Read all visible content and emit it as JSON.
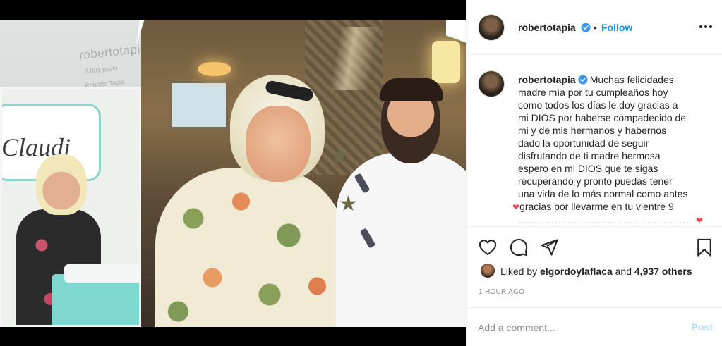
{
  "post": {
    "username": "robertotapia",
    "verified": true,
    "separator": "•",
    "follow_label": "Follow",
    "caption_lines": [
      "Muchas felicidades",
      "madre mía por tu cumpleaños hoy",
      "como todos los días le doy gracias a",
      "mi DIOS por haberse compadecido de",
      "mi y de mis hermanos y habernos",
      "dado la oportunidad de seguir",
      "disfrutando de ti madre hermosa",
      "espero en mi DIOS que te sigas",
      "recuperando y pronto puedas tener",
      "una vida de lo más normal como antes",
      "gracias por llevarme en tu vientre 9"
    ],
    "likes": {
      "prefix": "Liked by",
      "liker": "elgordoylaflaca",
      "joiner": "and",
      "others": "4,937 others"
    },
    "timestamp": "1 HOUR AGO",
    "comment_placeholder": "Add a comment...",
    "post_label": "Post"
  },
  "photo": {
    "collage_handle": "robertotapia",
    "collage_stat": "3,001 posts",
    "collage_name": "Roberto Tapia",
    "inset_banner": "Claudi"
  },
  "icons": {
    "more": "more-options-icon",
    "verified": "verified-badge-icon",
    "like": "heart-icon",
    "comment": "comment-icon",
    "share": "paper-plane-icon",
    "save": "bookmark-icon"
  },
  "colors": {
    "accent": "#0095f6",
    "post_disabled": "#b2dffc",
    "muted": "#8e8e8e",
    "text": "#262626",
    "heart_emoji": "#ed4956"
  }
}
